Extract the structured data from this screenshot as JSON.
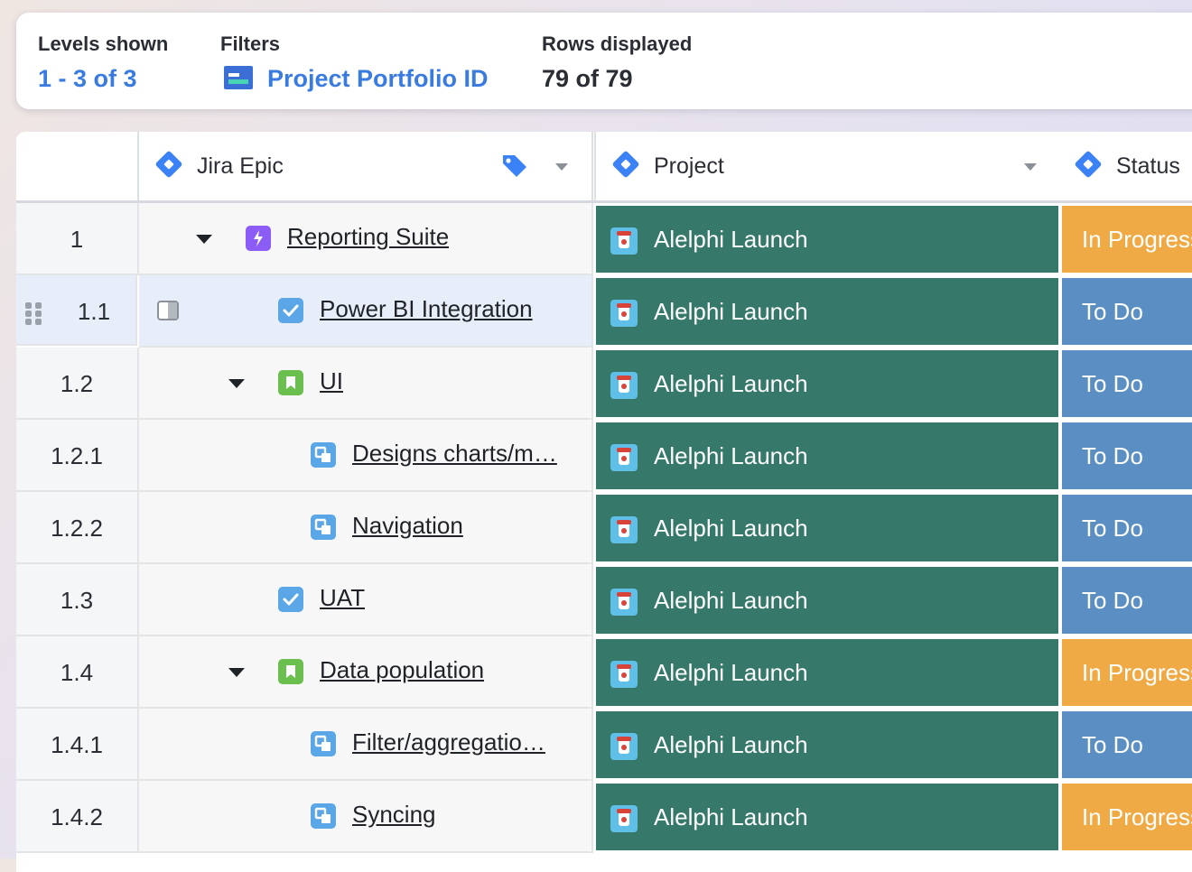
{
  "summary": {
    "levels_label": "Levels shown",
    "levels_value": "1 - 3 of 3",
    "filters_label": "Filters",
    "filters_value": "Project Portfolio ID",
    "rows_label": "Rows displayed",
    "rows_value": "79 of 79"
  },
  "columns": {
    "epic": "Jira Epic",
    "project": "Project",
    "status": "Status"
  },
  "icons": {
    "column_type": "jira-diamond-icon",
    "tag": "tag-icon",
    "dropdown": "chevron-down-icon",
    "project": "alelphi-cup-icon"
  },
  "colors": {
    "project_bg": "#36796a",
    "todo": "#5b8fc4",
    "in_progress": "#f0aa45",
    "link": "#3a7be0"
  },
  "rows": [
    {
      "num": "1",
      "title": "Reporting Suite",
      "project": "Alelphi Launch",
      "status": "In Progress"
    },
    {
      "num": "1.1",
      "title": "Power BI Integration",
      "project": "Alelphi Launch",
      "status": "To Do"
    },
    {
      "num": "1.2",
      "title": "UI",
      "project": "Alelphi Launch",
      "status": "To Do"
    },
    {
      "num": "1.2.1",
      "title": "Designs charts/m…",
      "project": "Alelphi Launch",
      "status": "To Do"
    },
    {
      "num": "1.2.2",
      "title": "Navigation",
      "project": "Alelphi Launch",
      "status": "To Do"
    },
    {
      "num": "1.3",
      "title": "UAT",
      "project": "Alelphi Launch",
      "status": "To Do"
    },
    {
      "num": "1.4",
      "title": "Data population",
      "project": "Alelphi Launch",
      "status": "In Progress"
    },
    {
      "num": "1.4.1",
      "title": "Filter/aggregatio…",
      "project": "Alelphi Launch",
      "status": "To Do"
    },
    {
      "num": "1.4.2",
      "title": "Syncing",
      "project": "Alelphi Launch",
      "status": "In Progress"
    }
  ]
}
